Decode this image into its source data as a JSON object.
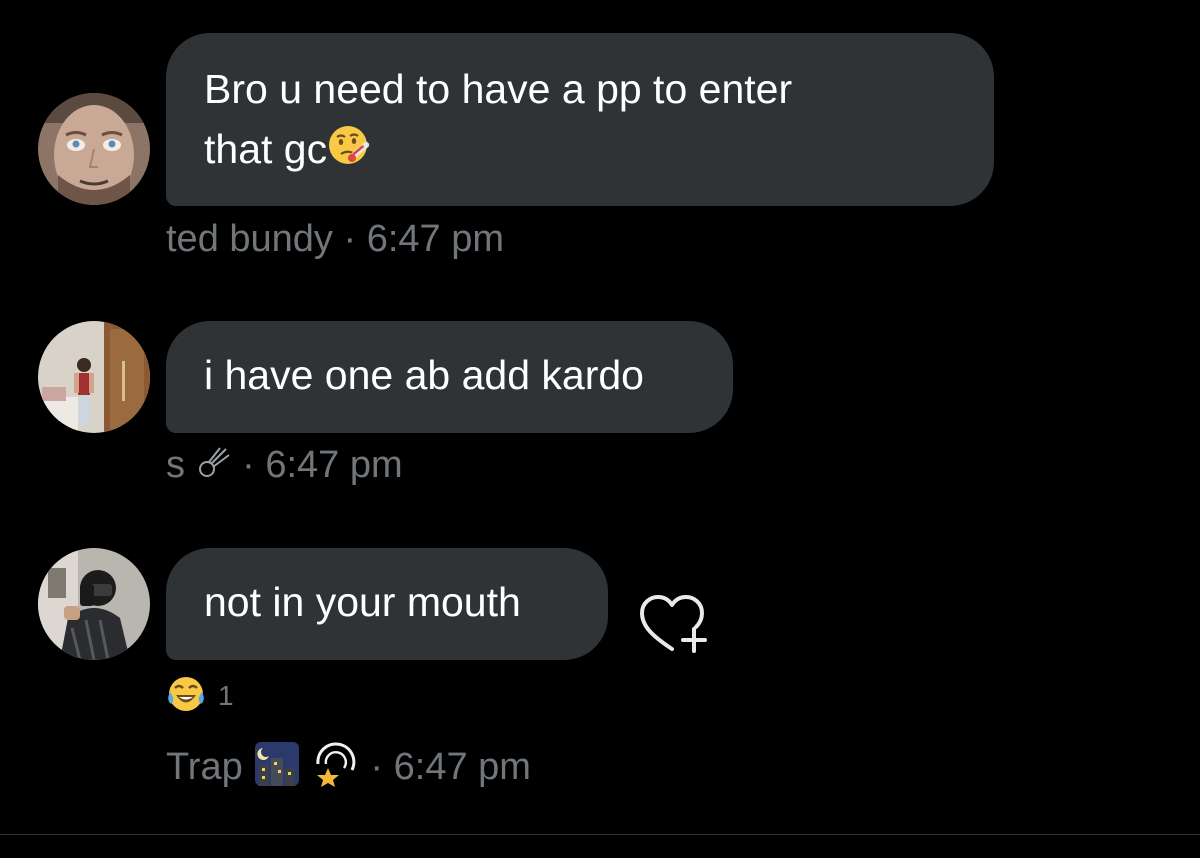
{
  "messages": [
    {
      "text_line1": "Bro u need to have a pp to enter",
      "text_line2": "that gc",
      "inline_emoji": "face-with-thermometer",
      "sender": "ted bundy",
      "separator": "·",
      "time": "6:47 pm"
    },
    {
      "text": "i have one ab add kardo",
      "sender": "s",
      "sender_emoji": "comet",
      "separator": "·",
      "time": "6:47 pm"
    },
    {
      "text": "not in your mouth",
      "reaction": {
        "emoji": "face-with-tears-of-joy",
        "count": "1"
      },
      "sender": "Trap",
      "sender_emojis": [
        "night-city",
        "dizzy-star"
      ],
      "separator": "·",
      "time": "6:47 pm"
    }
  ],
  "icons": {
    "add_reaction": "heart-plus-icon"
  },
  "colors": {
    "background": "#000000",
    "bubble": "#2f3336",
    "text": "#ffffff",
    "meta": "#71767b"
  }
}
